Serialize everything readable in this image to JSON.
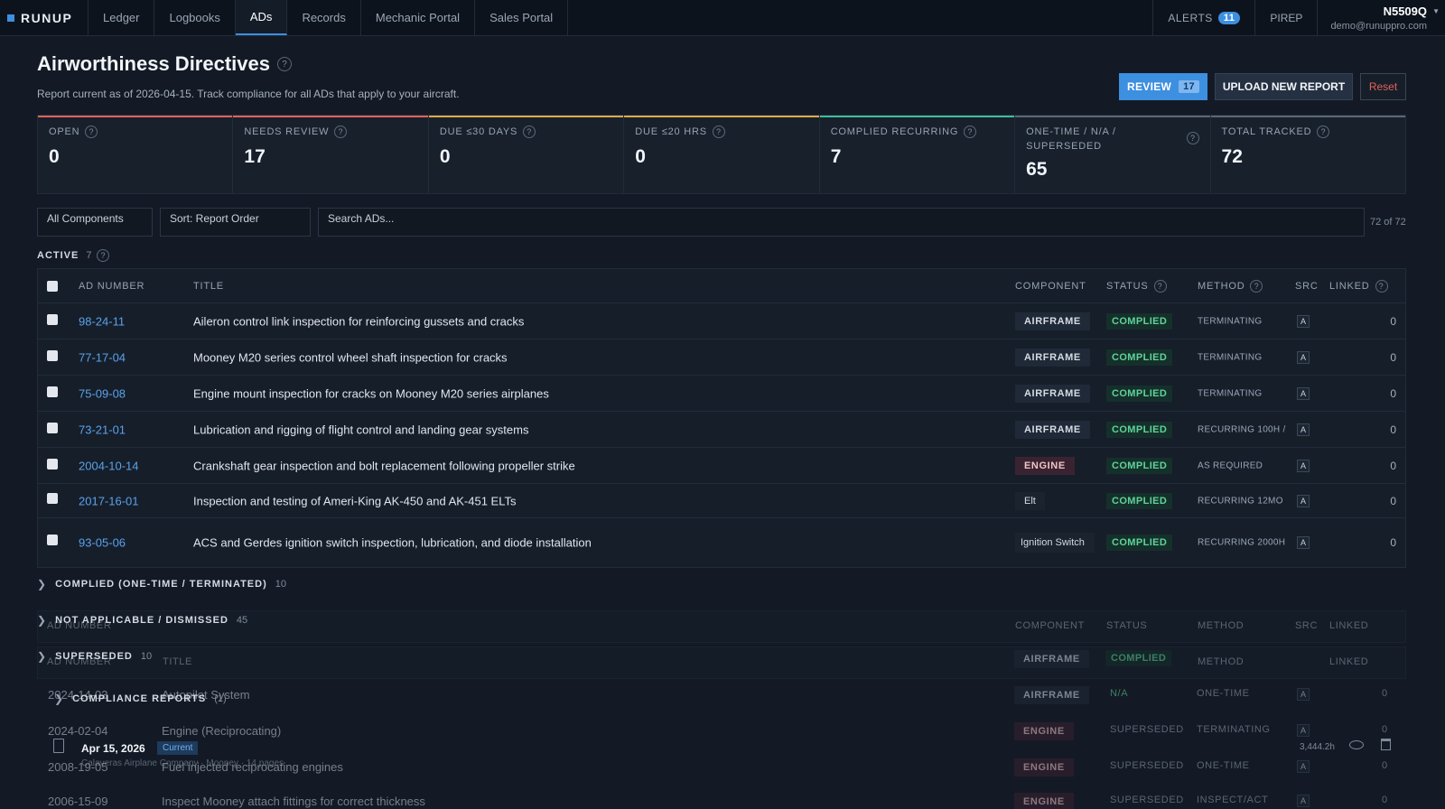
{
  "app": {
    "logo": "RUNUP",
    "nav": [
      "Ledger",
      "Logbooks",
      "ADs",
      "Records",
      "Mechanic Portal",
      "Sales Portal"
    ],
    "active_nav": "ADs",
    "alerts_label": "ALERTS",
    "alerts_count": "11",
    "pirep_label": "PIREP",
    "tail_number": "N5509Q",
    "email": "demo@runuppro.com"
  },
  "header": {
    "title": "Airworthiness Directives",
    "subtitle": "Report current as of 2026-04-15. Track compliance for all ADs that apply to your aircraft.",
    "review_label": "REVIEW",
    "review_count": "17",
    "upload_label": "UPLOAD NEW REPORT",
    "reset_label": "Reset"
  },
  "stats": [
    {
      "label": "OPEN",
      "value": "0",
      "accent": "#e0625a"
    },
    {
      "label": "NEEDS REVIEW",
      "value": "17",
      "accent": "#e0625a"
    },
    {
      "label": "DUE ≤30 DAYS",
      "value": "0",
      "accent": "#e0a94a"
    },
    {
      "label": "DUE ≤20 HRS",
      "value": "0",
      "accent": "#e0a94a"
    },
    {
      "label": "COMPLIED RECURRING",
      "value": "7",
      "accent": "#3fbf9a"
    },
    {
      "label": "ONE-TIME / N/A / SUPERSEDED",
      "value": "65",
      "accent": "#5b6778"
    },
    {
      "label": "TOTAL TRACKED",
      "value": "72",
      "accent": "#5b6778"
    }
  ],
  "filters": {
    "component": "All Components",
    "sort": "Sort: Report Order",
    "search_placeholder": "Search ADs...",
    "count": "72 of 72"
  },
  "active_section": {
    "label": "ACTIVE",
    "count": "7"
  },
  "columns": {
    "ad_number": "AD NUMBER",
    "title": "TITLE",
    "component": "COMPONENT",
    "status": "STATUS",
    "method": "METHOD",
    "src": "SRC",
    "linked": "LINKED"
  },
  "rows": [
    {
      "ad": "98-24-11",
      "title": "Aileron control link inspection for reinforcing gussets and cracks",
      "component": "AIRFRAME",
      "status": "COMPLIED",
      "method": "TERMINATING",
      "src": "A",
      "linked": "0"
    },
    {
      "ad": "77-17-04",
      "title": "Mooney M20 series control wheel shaft inspection for cracks",
      "component": "AIRFRAME",
      "status": "COMPLIED",
      "method": "TERMINATING",
      "src": "A",
      "linked": "0"
    },
    {
      "ad": "75-09-08",
      "title": "Engine mount inspection for cracks on Mooney M20 series airplanes",
      "component": "AIRFRAME",
      "status": "COMPLIED",
      "method": "TERMINATING",
      "src": "A",
      "linked": "0"
    },
    {
      "ad": "73-21-01",
      "title": "Lubrication and rigging of flight control and landing gear systems",
      "component": "AIRFRAME",
      "status": "COMPLIED",
      "method": "RECURRING 100H /",
      "src": "A",
      "linked": "0"
    },
    {
      "ad": "2004-10-14",
      "title": "Crankshaft gear inspection and bolt replacement following propeller strike",
      "component": "ENGINE",
      "status": "COMPLIED",
      "method": "AS REQUIRED",
      "src": "A",
      "linked": "0"
    },
    {
      "ad": "2017-16-01",
      "title": "Inspection and testing of Ameri-King AK-450 and AK-451 ELTs",
      "component": "Elt",
      "status": "COMPLIED",
      "method": "RECURRING 12MO",
      "src": "A",
      "linked": "0"
    },
    {
      "ad": "93-05-06",
      "title": "ACS and Gerdes ignition switch inspection, lubrication, and diode installation",
      "component": "Ignition Switch",
      "status": "COMPLIED",
      "method": "RECURRING 2000H",
      "src": "A",
      "linked": "0"
    }
  ],
  "collapsed_sections": [
    {
      "label": "COMPLIED (ONE-TIME / TERMINATED)",
      "count": "10"
    },
    {
      "label": "NOT APPLICABLE / DISMISSED",
      "count": "45"
    },
    {
      "label": "SUPERSEDED",
      "count": "10"
    },
    {
      "label": "COMPLIANCE REPORTS",
      "count": "(1)"
    }
  ],
  "ghost": {
    "rows": [
      {
        "ad": "2024-14-03",
        "title": "Autopilot System",
        "component": "AIRFRAME",
        "status": "N/A",
        "method": "ONE-TIME",
        "src": "A",
        "linked": "0"
      },
      {
        "ad": "2024-02-04",
        "title": "Engine (Reciprocating)",
        "component": "ENGINE",
        "status": "SUPERSEDED",
        "method": "TERMINATING",
        "src": "A",
        "linked": "0"
      },
      {
        "ad": "2008-19-05",
        "title": "Fuel injected reciprocating engines",
        "component": "ENGINE",
        "status": "SUPERSEDED",
        "method": "ONE-TIME",
        "src": "A",
        "linked": "0"
      },
      {
        "ad": "2006-15-09",
        "title": "Inspect Mooney attach fittings for correct thickness",
        "component": "ENGINE",
        "status": "SUPERSEDED",
        "method": "INSPECT/ACT",
        "src": "A",
        "linked": "0"
      }
    ],
    "report": {
      "date": "Apr 15, 2026",
      "badge": "Current",
      "desc": "Calaveras Airplane Company · Mooney · 14 pages",
      "hours": "3,444.2h"
    }
  }
}
